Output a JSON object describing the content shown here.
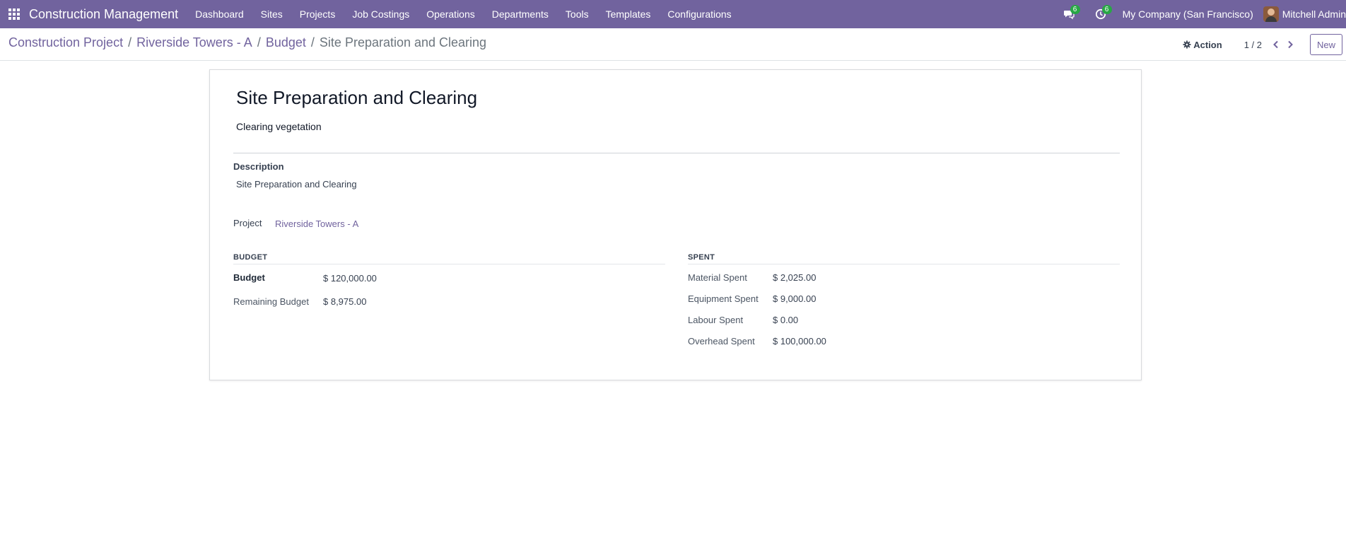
{
  "navbar": {
    "brand": "Construction Management",
    "menu": [
      "Dashboard",
      "Sites",
      "Projects",
      "Job Costings",
      "Operations",
      "Departments",
      "Tools",
      "Templates",
      "Configurations"
    ],
    "messages_count": "6",
    "activities_count": "6",
    "company": "My Company (San Francisco)",
    "user": "Mitchell Admin"
  },
  "breadcrumb": {
    "items": [
      "Construction Project",
      "Riverside Towers - A",
      "Budget"
    ],
    "current": "Site Preparation and Clearing",
    "separator": "/"
  },
  "control": {
    "action_label": "Action",
    "pager": "1 / 2",
    "new_label": "New"
  },
  "record": {
    "title": "Site Preparation and Clearing",
    "subtitle": "Clearing vegetation",
    "description_label": "Description",
    "description_value": "Site Preparation and Clearing",
    "project_label": "Project",
    "project_value": "Riverside Towers - A",
    "budget_group": {
      "title": "BUDGET",
      "rows": [
        {
          "label": "Budget",
          "value": "$ 120,000.00"
        },
        {
          "label": "Remaining Budget",
          "value": "$ 8,975.00"
        }
      ]
    },
    "spent_group": {
      "title": "SPENT",
      "rows": [
        {
          "label": "Material Spent",
          "value": "$ 2,025.00"
        },
        {
          "label": "Equipment Spent",
          "value": "$ 9,000.00"
        },
        {
          "label": "Labour Spent",
          "value": "$ 0.00"
        },
        {
          "label": "Overhead Spent",
          "value": "$ 100,000.00"
        }
      ]
    }
  },
  "colors": {
    "navbar_bg": "#71639e",
    "link": "#71639e",
    "badge": "#28a745"
  }
}
